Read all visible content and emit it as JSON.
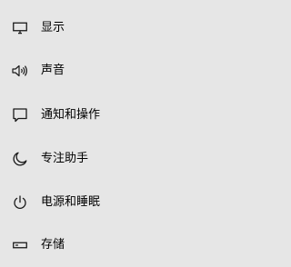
{
  "nav": {
    "items": [
      {
        "label": "显示",
        "icon": "monitor-icon"
      },
      {
        "label": "声音",
        "icon": "speaker-icon"
      },
      {
        "label": "通知和操作",
        "icon": "notification-icon"
      },
      {
        "label": "专注助手",
        "icon": "moon-icon"
      },
      {
        "label": "电源和睡眠",
        "icon": "power-icon"
      },
      {
        "label": "存储",
        "icon": "storage-icon"
      }
    ]
  },
  "colors": {
    "background": "#e6e6e6",
    "text": "#000000",
    "icon": "#1a1a1a"
  }
}
